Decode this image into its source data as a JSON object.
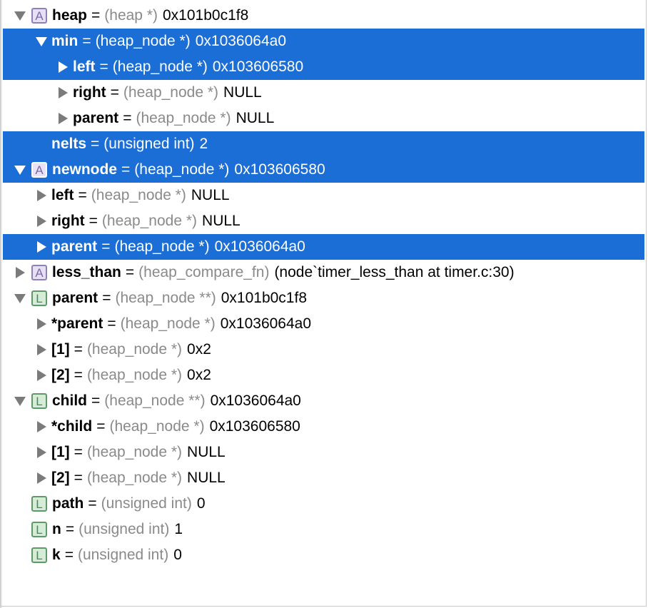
{
  "variables": [
    {
      "indent": 0,
      "triangle": "open",
      "badge": "A",
      "name": "heap",
      "type": "(heap *)",
      "value": "0x101b0c1f8",
      "selected": false
    },
    {
      "indent": 1,
      "triangle": "open",
      "badge": "",
      "name": "min",
      "type": "(heap_node *)",
      "value": "0x1036064a0",
      "selected": true
    },
    {
      "indent": 2,
      "triangle": "closed",
      "badge": "",
      "name": "left",
      "type": "(heap_node *)",
      "value": "0x103606580",
      "selected": true
    },
    {
      "indent": 2,
      "triangle": "closed",
      "badge": "",
      "name": "right",
      "type": "(heap_node *)",
      "value": "NULL",
      "selected": false
    },
    {
      "indent": 2,
      "triangle": "closed",
      "badge": "",
      "name": "parent",
      "type": "(heap_node *)",
      "value": "NULL",
      "selected": false
    },
    {
      "indent": 1,
      "triangle": "none",
      "badge": "",
      "name": "nelts",
      "type": "(unsigned int)",
      "value": "2",
      "selected": true
    },
    {
      "indent": 0,
      "triangle": "open",
      "badge": "A",
      "name": "newnode",
      "type": "(heap_node *)",
      "value": "0x103606580",
      "selected": true
    },
    {
      "indent": 1,
      "triangle": "closed",
      "badge": "",
      "name": "left",
      "type": "(heap_node *)",
      "value": "NULL",
      "selected": false
    },
    {
      "indent": 1,
      "triangle": "closed",
      "badge": "",
      "name": "right",
      "type": "(heap_node *)",
      "value": "NULL",
      "selected": false
    },
    {
      "indent": 1,
      "triangle": "closed",
      "badge": "",
      "name": "parent",
      "type": "(heap_node *)",
      "value": "0x1036064a0",
      "selected": true
    },
    {
      "indent": 0,
      "triangle": "closed",
      "badge": "A",
      "name": "less_than",
      "type": "(heap_compare_fn)",
      "value": "(node`timer_less_than at timer.c:30)",
      "selected": false
    },
    {
      "indent": 0,
      "triangle": "open",
      "badge": "L",
      "name": "parent",
      "type": "(heap_node **)",
      "value": "0x101b0c1f8",
      "selected": false
    },
    {
      "indent": 1,
      "triangle": "closed",
      "badge": "",
      "name": "*parent",
      "type": "(heap_node *)",
      "value": "0x1036064a0",
      "selected": false
    },
    {
      "indent": 1,
      "triangle": "closed",
      "badge": "",
      "name": "[1]",
      "type": "(heap_node *)",
      "value": "0x2",
      "selected": false
    },
    {
      "indent": 1,
      "triangle": "closed",
      "badge": "",
      "name": "[2]",
      "type": "(heap_node *)",
      "value": "0x2",
      "selected": false
    },
    {
      "indent": 0,
      "triangle": "open",
      "badge": "L",
      "name": "child",
      "type": "(heap_node **)",
      "value": "0x1036064a0",
      "selected": false
    },
    {
      "indent": 1,
      "triangle": "closed",
      "badge": "",
      "name": "*child",
      "type": "(heap_node *)",
      "value": "0x103606580",
      "selected": false
    },
    {
      "indent": 1,
      "triangle": "closed",
      "badge": "",
      "name": "[1]",
      "type": "(heap_node *)",
      "value": "NULL",
      "selected": false
    },
    {
      "indent": 1,
      "triangle": "closed",
      "badge": "",
      "name": "[2]",
      "type": "(heap_node *)",
      "value": "NULL",
      "selected": false
    },
    {
      "indent": 0,
      "triangle": "none",
      "badge": "L",
      "name": "path",
      "type": "(unsigned int)",
      "value": "0",
      "selected": false
    },
    {
      "indent": 0,
      "triangle": "none",
      "badge": "L",
      "name": "n",
      "type": "(unsigned int)",
      "value": "1",
      "selected": false
    },
    {
      "indent": 0,
      "triangle": "none",
      "badge": "L",
      "name": "k",
      "type": "(unsigned int)",
      "value": "0",
      "selected": false
    }
  ],
  "badge_letters": {
    "A": "A",
    "L": "L"
  },
  "colors": {
    "selection": "#1b6ed6",
    "type_text": "#8a8a8a",
    "badge_A": "#8f80b8",
    "badge_L": "#5e9a68"
  }
}
